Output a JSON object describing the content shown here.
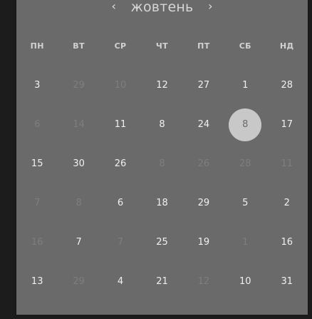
{
  "calendar": {
    "month_label": "жовтень",
    "prev_label": "‹",
    "next_label": "›",
    "weekdays": [
      "ПН",
      "ВТ",
      "СР",
      "ЧТ",
      "ПТ",
      "СБ",
      "НД"
    ],
    "rows": [
      [
        {
          "label": "3",
          "muted": false
        },
        {
          "label": "29",
          "muted": true
        },
        {
          "label": "10",
          "muted": true
        },
        {
          "label": "12",
          "muted": false
        },
        {
          "label": "27",
          "muted": false
        },
        {
          "label": "1",
          "muted": false
        },
        {
          "label": "28",
          "muted": false
        }
      ],
      [
        {
          "label": "6",
          "muted": true
        },
        {
          "label": "14",
          "muted": true
        },
        {
          "label": "11",
          "muted": false
        },
        {
          "label": "8",
          "muted": false
        },
        {
          "label": "24",
          "muted": false
        },
        {
          "label": "8",
          "muted": false,
          "selected": true
        },
        {
          "label": "17",
          "muted": false
        }
      ],
      [
        {
          "label": "15",
          "muted": false
        },
        {
          "label": "30",
          "muted": false
        },
        {
          "label": "26",
          "muted": false
        },
        {
          "label": "8",
          "muted": true
        },
        {
          "label": "26",
          "muted": true
        },
        {
          "label": "28",
          "muted": true
        },
        {
          "label": "11",
          "muted": true
        }
      ],
      [
        {
          "label": "7",
          "muted": true
        },
        {
          "label": "8",
          "muted": true
        },
        {
          "label": "6",
          "muted": false
        },
        {
          "label": "18",
          "muted": false
        },
        {
          "label": "29",
          "muted": false
        },
        {
          "label": "5",
          "muted": false
        },
        {
          "label": "2",
          "muted": false
        }
      ],
      [
        {
          "label": "16",
          "muted": true
        },
        {
          "label": "7",
          "muted": false
        },
        {
          "label": "7",
          "muted": true
        },
        {
          "label": "25",
          "muted": false
        },
        {
          "label": "19",
          "muted": false
        },
        {
          "label": "1",
          "muted": true
        },
        {
          "label": "16",
          "muted": false
        }
      ],
      [
        {
          "label": "13",
          "muted": false
        },
        {
          "label": "29",
          "muted": true
        },
        {
          "label": "4",
          "muted": false
        },
        {
          "label": "21",
          "muted": false
        },
        {
          "label": "12",
          "muted": true
        },
        {
          "label": "10",
          "muted": false
        },
        {
          "label": "31",
          "muted": false
        }
      ]
    ],
    "colors": {
      "panel": "#6a6a6a",
      "page": "#1c1c1c",
      "text": "#f0f0f0",
      "muted_text": "#7e7e7e",
      "selected_fill": "#c8c8c8"
    }
  }
}
